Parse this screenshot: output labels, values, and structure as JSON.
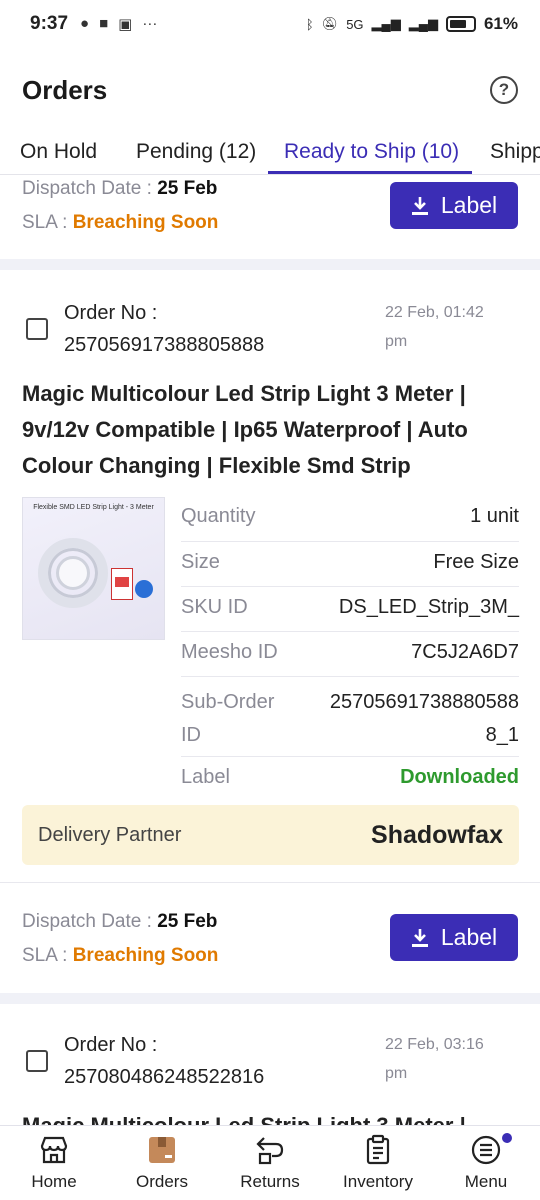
{
  "status_bar": {
    "time": "9:37",
    "network": "5G",
    "battery": "61%"
  },
  "header": {
    "title": "Orders",
    "help_icon": "question-circle-icon"
  },
  "tabs": [
    {
      "label": "On Hold"
    },
    {
      "label": "Pending (12)"
    },
    {
      "label": "Ready to Ship (10)",
      "active": true
    },
    {
      "label": "Shipp"
    }
  ],
  "orders": [
    {
      "dispatch_label": "Dispatch Date :",
      "dispatch_date": "25 Feb",
      "sla_label": "SLA :",
      "sla_value": "Breaching Soon",
      "label_button": "Label"
    },
    {
      "order_no_label": "Order No :",
      "order_no": "257056917388805888",
      "date_line1": "22 Feb, 01:42",
      "date_line2": "pm",
      "title_lines": [
        "Magic Multicolour Led Strip Light 3 Meter |",
        "9v/12v Compatible | Ip65 Waterproof | Auto",
        "Colour Changing | Flexible Smd Strip"
      ],
      "thumbnail_caption": "Flexible SMD LED Strip Light - 3 Meter",
      "details": [
        {
          "key": "Quantity",
          "value": "1 unit"
        },
        {
          "key": "Size",
          "value": "Free Size"
        },
        {
          "key": "SKU ID",
          "value": "DS_LED_Strip_3M_"
        },
        {
          "key": "Meesho ID",
          "value": "7C5J2A6D7"
        },
        {
          "key_line1": "Sub-Order",
          "key_line2": "ID",
          "value_line1": "25705691738880588",
          "value_line2": "8_1"
        },
        {
          "key": "Label",
          "value": "Downloaded"
        }
      ],
      "delivery_partner_label": "Delivery Partner",
      "delivery_partner": "Shadowfax",
      "dispatch_label": "Dispatch Date :",
      "dispatch_date": "25 Feb",
      "sla_label": "SLA :",
      "sla_value": "Breaching Soon",
      "label_button": "Label"
    },
    {
      "order_no_label": "Order No :",
      "order_no": "257080486248522816",
      "date_line1": "22 Feb, 03:16",
      "date_line2": "pm",
      "title_partial": "Magic Multicolour Led Strip Light 3 Meter |"
    }
  ],
  "colors": {
    "primary": "#3b2db5",
    "sla_warning": "#e07a00",
    "success": "#2e9a2e",
    "partner_bg": "#fbf3d8"
  },
  "bottom_nav": [
    {
      "label": "Home",
      "icon": "store-icon"
    },
    {
      "label": "Orders",
      "icon": "box-icon",
      "active": true
    },
    {
      "label": "Returns",
      "icon": "return-icon"
    },
    {
      "label": "Inventory",
      "icon": "clipboard-icon"
    },
    {
      "label": "Menu",
      "icon": "menu-icon",
      "badge": true
    }
  ]
}
